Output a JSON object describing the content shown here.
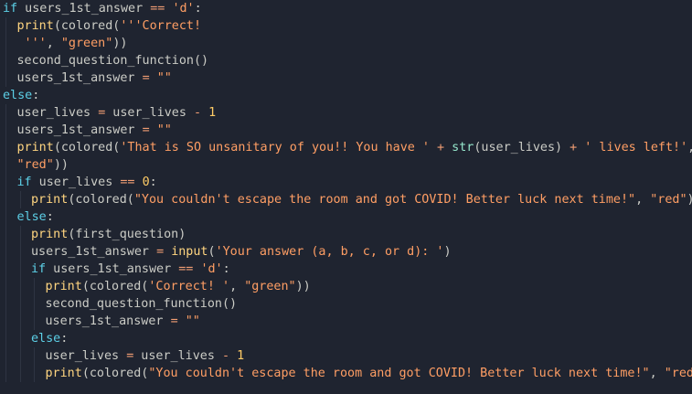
{
  "editor": {
    "colors": {
      "background": "#1f2430",
      "keyword": "#5ccfe6",
      "function": "#ffd580",
      "builtin": "#95e6cb",
      "string": "#ff9e64",
      "operator": "#f29e74",
      "number": "#ffcc66",
      "text": "#cbccc6",
      "indent_guide": "#2e3442"
    },
    "lines": [
      {
        "indent": 0,
        "tokens": [
          {
            "t": "keyword",
            "v": "if"
          },
          {
            "t": "text",
            "v": " users_1st_answer "
          },
          {
            "t": "operator",
            "v": "=="
          },
          {
            "t": "text",
            "v": " "
          },
          {
            "t": "string",
            "v": "'d'"
          },
          {
            "t": "text",
            "v": ":"
          }
        ]
      },
      {
        "indent": 1,
        "tokens": [
          {
            "t": "function",
            "v": "print"
          },
          {
            "t": "text",
            "v": "(colored("
          },
          {
            "t": "string",
            "v": "'''Correct!"
          }
        ]
      },
      {
        "indent": 1,
        "tokens": [
          {
            "t": "string",
            "v": " '''"
          },
          {
            "t": "text",
            "v": ", "
          },
          {
            "t": "string",
            "v": "\"green\""
          },
          {
            "t": "text",
            "v": "))"
          }
        ]
      },
      {
        "indent": 1,
        "tokens": [
          {
            "t": "text",
            "v": "second_question_function()"
          }
        ]
      },
      {
        "indent": 1,
        "tokens": [
          {
            "t": "text",
            "v": "users_1st_answer "
          },
          {
            "t": "operator",
            "v": "="
          },
          {
            "t": "text",
            "v": " "
          },
          {
            "t": "string",
            "v": "\"\""
          }
        ]
      },
      {
        "indent": 0,
        "tokens": [
          {
            "t": "keyword",
            "v": "else"
          },
          {
            "t": "text",
            "v": ":"
          }
        ]
      },
      {
        "indent": 1,
        "tokens": [
          {
            "t": "text",
            "v": "user_lives "
          },
          {
            "t": "operator",
            "v": "="
          },
          {
            "t": "text",
            "v": " user_lives "
          },
          {
            "t": "operator",
            "v": "-"
          },
          {
            "t": "text",
            "v": " "
          },
          {
            "t": "number",
            "v": "1"
          }
        ]
      },
      {
        "indent": 1,
        "tokens": [
          {
            "t": "text",
            "v": "users_1st_answer "
          },
          {
            "t": "operator",
            "v": "="
          },
          {
            "t": "text",
            "v": " "
          },
          {
            "t": "string",
            "v": "\"\""
          }
        ]
      },
      {
        "indent": 1,
        "tokens": [
          {
            "t": "function",
            "v": "print"
          },
          {
            "t": "text",
            "v": "(colored("
          },
          {
            "t": "string",
            "v": "'That is SO unsanitary of you!! You have '"
          },
          {
            "t": "text",
            "v": " "
          },
          {
            "t": "operator",
            "v": "+"
          },
          {
            "t": "text",
            "v": " "
          },
          {
            "t": "builtin",
            "v": "str"
          },
          {
            "t": "text",
            "v": "(user_lives) "
          },
          {
            "t": "operator",
            "v": "+"
          },
          {
            "t": "text",
            "v": " "
          },
          {
            "t": "string",
            "v": "' lives left!'"
          },
          {
            "t": "text",
            "v": ","
          }
        ]
      },
      {
        "indent": 1,
        "tokens": [
          {
            "t": "string",
            "v": "\"red\""
          },
          {
            "t": "text",
            "v": "))"
          }
        ]
      },
      {
        "indent": 1,
        "tokens": [
          {
            "t": "keyword",
            "v": "if"
          },
          {
            "t": "text",
            "v": " user_lives "
          },
          {
            "t": "operator",
            "v": "=="
          },
          {
            "t": "text",
            "v": " "
          },
          {
            "t": "number",
            "v": "0"
          },
          {
            "t": "text",
            "v": ":"
          }
        ]
      },
      {
        "indent": 2,
        "tokens": [
          {
            "t": "function",
            "v": "print"
          },
          {
            "t": "text",
            "v": "(colored("
          },
          {
            "t": "string",
            "v": "\"You couldn't escape the room and got COVID! Better luck next time!\""
          },
          {
            "t": "text",
            "v": ", "
          },
          {
            "t": "string",
            "v": "\"red\""
          },
          {
            "t": "text",
            "v": "))"
          }
        ]
      },
      {
        "indent": 1,
        "tokens": [
          {
            "t": "keyword",
            "v": "else"
          },
          {
            "t": "text",
            "v": ":"
          }
        ]
      },
      {
        "indent": 2,
        "tokens": [
          {
            "t": "function",
            "v": "print"
          },
          {
            "t": "text",
            "v": "(first_question)"
          }
        ]
      },
      {
        "indent": 2,
        "tokens": [
          {
            "t": "text",
            "v": "users_1st_answer "
          },
          {
            "t": "operator",
            "v": "="
          },
          {
            "t": "text",
            "v": " "
          },
          {
            "t": "function",
            "v": "input"
          },
          {
            "t": "text",
            "v": "("
          },
          {
            "t": "string",
            "v": "'Your answer (a, b, c, or d): '"
          },
          {
            "t": "text",
            "v": ")"
          }
        ]
      },
      {
        "indent": 2,
        "tokens": [
          {
            "t": "keyword",
            "v": "if"
          },
          {
            "t": "text",
            "v": " users_1st_answer "
          },
          {
            "t": "operator",
            "v": "=="
          },
          {
            "t": "text",
            "v": " "
          },
          {
            "t": "string",
            "v": "'d'"
          },
          {
            "t": "text",
            "v": ":"
          }
        ]
      },
      {
        "indent": 3,
        "tokens": [
          {
            "t": "function",
            "v": "print"
          },
          {
            "t": "text",
            "v": "(colored("
          },
          {
            "t": "string",
            "v": "'Correct! '"
          },
          {
            "t": "text",
            "v": ", "
          },
          {
            "t": "string",
            "v": "\"green\""
          },
          {
            "t": "text",
            "v": "))"
          }
        ]
      },
      {
        "indent": 3,
        "tokens": [
          {
            "t": "text",
            "v": "second_question_function()"
          }
        ]
      },
      {
        "indent": 3,
        "tokens": [
          {
            "t": "text",
            "v": "users_1st_answer "
          },
          {
            "t": "operator",
            "v": "="
          },
          {
            "t": "text",
            "v": " "
          },
          {
            "t": "string",
            "v": "\"\""
          }
        ]
      },
      {
        "indent": 2,
        "tokens": [
          {
            "t": "keyword",
            "v": "else"
          },
          {
            "t": "text",
            "v": ":"
          }
        ]
      },
      {
        "indent": 3,
        "tokens": [
          {
            "t": "text",
            "v": "user_lives "
          },
          {
            "t": "operator",
            "v": "="
          },
          {
            "t": "text",
            "v": " user_lives "
          },
          {
            "t": "operator",
            "v": "-"
          },
          {
            "t": "text",
            "v": " "
          },
          {
            "t": "number",
            "v": "1"
          }
        ]
      },
      {
        "indent": 3,
        "tokens": [
          {
            "t": "function",
            "v": "print"
          },
          {
            "t": "text",
            "v": "(colored("
          },
          {
            "t": "string",
            "v": "\"You couldn't escape the room and got COVID! Better luck next time!\""
          },
          {
            "t": "text",
            "v": ", "
          },
          {
            "t": "string",
            "v": "\"red\""
          },
          {
            "t": "text",
            "v": "))"
          }
        ]
      }
    ]
  }
}
